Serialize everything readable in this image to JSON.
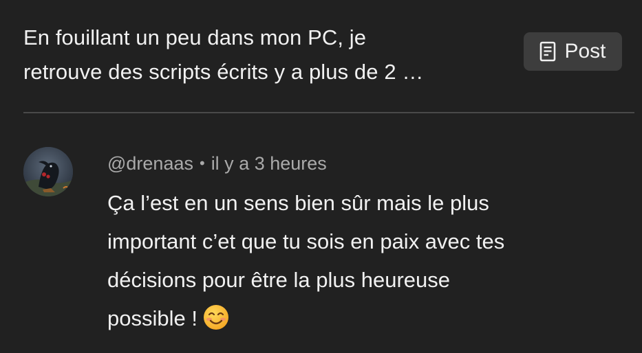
{
  "post": {
    "snippet_line1": "En fouillant un peu dans mon PC, je",
    "snippet_line2": "retrouve des scripts écrits y a plus de 2 …",
    "button_label": "Post",
    "button_icon": "document-icon"
  },
  "reply": {
    "author": "@drenaas",
    "separator": "•",
    "timestamp": "il y a 3 heures",
    "text_line1": "Ça l’est en un sens bien sûr mais le plus",
    "text_line2": "important c’et que tu sois en paix avec tes",
    "text_line3": "décisions pour être la plus heureuse",
    "text_line4": "possible !",
    "emoji": "smiling-face-emoji",
    "avatar_icon": "crow-avatar"
  },
  "colors": {
    "background": "#212121",
    "text_primary": "#f1f1f1",
    "text_secondary": "#aaaaaa",
    "button_bg": "#3d3d3d",
    "divider": "#4a4a4a"
  }
}
